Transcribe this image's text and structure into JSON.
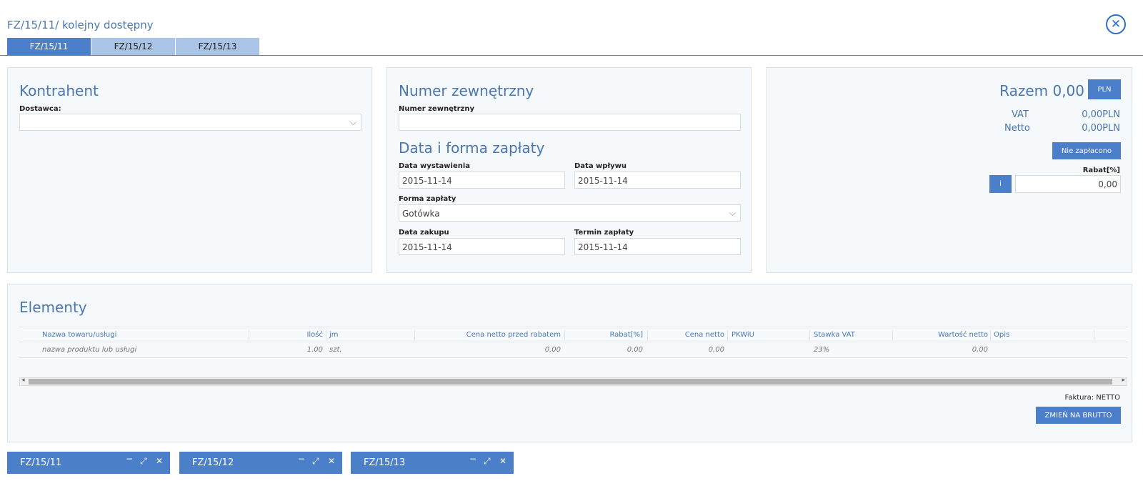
{
  "window": {
    "title": "FZ/15/11/ kolejny dostępny",
    "close_glyph": "✕"
  },
  "tabs": [
    {
      "label": "FZ/15/11",
      "active": true
    },
    {
      "label": "FZ/15/12",
      "active": false
    },
    {
      "label": "FZ/15/13",
      "active": false
    }
  ],
  "kontrahent": {
    "heading": "Kontrahent",
    "dostawca_label": "Dostawca:",
    "dostawca_value": ""
  },
  "numer": {
    "heading": "Numer zewnętrzny",
    "field_label": "Numer zewnętrzny",
    "field_value": ""
  },
  "platnosc": {
    "heading": "Data i forma zapłaty",
    "data_wystawienia_label": "Data wystawienia",
    "data_wystawienia_value": "2015-11-14",
    "data_wplywu_label": "Data wpływu",
    "data_wplywu_value": "2015-11-14",
    "forma_label": "Forma zapłaty",
    "forma_value": "Gotówka",
    "data_zakupu_label": "Data zakupu",
    "data_zakupu_value": "2015-11-14",
    "termin_label": "Termin zapłaty",
    "termin_value": "2015-11-14"
  },
  "summary": {
    "razem": "Razem 0,00",
    "currency_button": "PLN",
    "vat_label": "VAT",
    "vat_value": "0,00PLN",
    "netto_label": "Netto",
    "netto_value": "0,00PLN",
    "status_button": "Nie zapłacono",
    "rabat_label": "Rabat[%]",
    "info_button": "i",
    "rabat_value": "0,00"
  },
  "elementy": {
    "heading": "Elementy",
    "columns": [
      "Nazwa towaru/usługi",
      "Ilość",
      "jm",
      "Cena netto przed rabatem",
      "Rabat[%]",
      "Cena netto",
      "PKWiU",
      "Stawka VAT",
      "Wartość netto",
      "Opis"
    ],
    "row": [
      "nazwa produktu lub usługi",
      "1.00",
      "szt.",
      "0,00",
      "0,00",
      "0,00",
      "",
      "23%",
      "0,00",
      ""
    ],
    "faktura_label": "Faktura: NETTO",
    "switch_button": "ZMIEŃ NA BRUTTO"
  },
  "taskbar": [
    {
      "label": "FZ/15/11"
    },
    {
      "label": "FZ/15/12"
    },
    {
      "label": "FZ/15/13"
    }
  ],
  "icons": {
    "minimize": "−",
    "maximize": "⤢",
    "close": "✕",
    "chevron": "⌵",
    "scroll_left": "◂",
    "scroll_right": "▸"
  }
}
